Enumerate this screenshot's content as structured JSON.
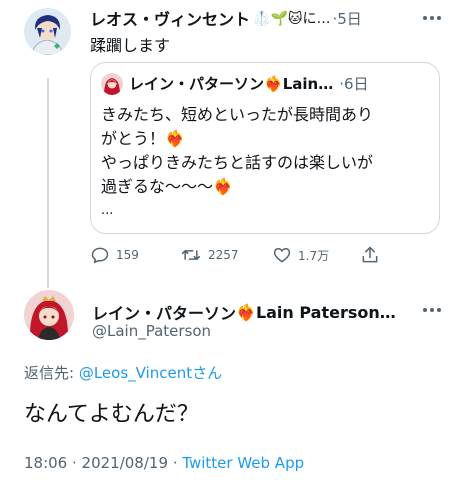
{
  "tweet1": {
    "author_name": "レオス・ヴィンセント",
    "author_emojis": "🥼🌱🐱に…",
    "time": "·5日",
    "text": "蹂躙します"
  },
  "quote": {
    "author_name": "レイン・パターソン",
    "author_emoji": "❤️‍🔥",
    "author_name_en": "Lain…",
    "time": "·6日",
    "lines": [
      "きみたち、短めといったが長時間あり",
      "がとう！❤️‍🔥",
      "やっぱりきみたちと話すのは楽しいが",
      "過ぎるな〜〜〜❤️‍🔥",
      "..."
    ]
  },
  "actions": {
    "reply_count": "159",
    "retweet_count": "2257",
    "like_count": "1.7万"
  },
  "tweet2": {
    "author_name": "レイン・パターソン",
    "author_emoji": "❤️‍🔥",
    "author_name_en": "Lain Paterson…",
    "handle": "@Lain_Paterson",
    "reply_prefix": "返信先: ",
    "reply_target": "@Leos_Vincentさん",
    "text": "なんてよむんだ？",
    "timestamp": "18:06 · 2021/08/19 · ",
    "source": "Twitter Web App"
  },
  "colors": {
    "link": "#1d9bf0",
    "secondary_text": "#536471",
    "border": "#cfd9de",
    "avatar_leos_bg": "#dfe9f2",
    "avatar_lain_bg": "#f2d3d3"
  },
  "icons": [
    "more-icon",
    "reply-icon",
    "retweet-icon",
    "like-icon",
    "share-icon"
  ]
}
